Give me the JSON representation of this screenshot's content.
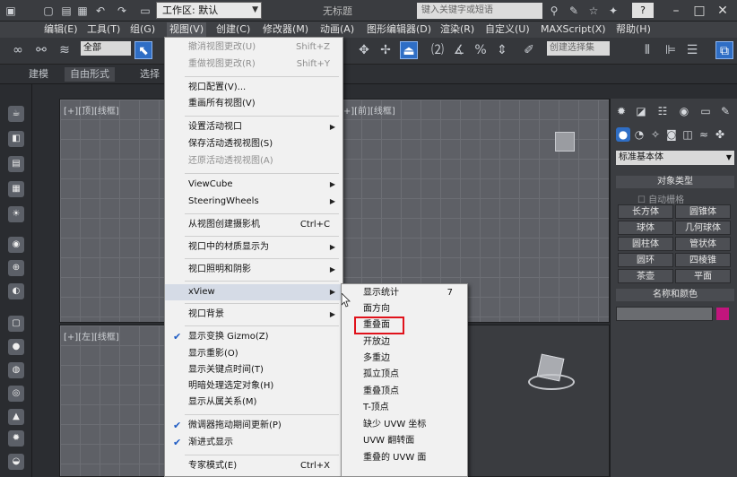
{
  "titlebar": {
    "workspace": "工作区: 默认",
    "title": "无标题",
    "search_placeholder": "键入关键字或短语",
    "help": "?"
  },
  "menubar": {
    "items": [
      "编辑(E)",
      "工具(T)",
      "组(G)",
      "视图(V)",
      "创建(C)",
      "修改器(M)",
      "动画(A)",
      "图形编辑器(D)",
      "渲染(R)",
      "自定义(U)",
      "MAXScript(X)",
      "帮助(H)"
    ]
  },
  "toolbar": {
    "selection_filter": "全部",
    "named_selection": "创建选择集"
  },
  "ribbon": {
    "tabs": [
      "建模",
      "自由形式",
      "选择"
    ]
  },
  "viewports": {
    "top_left_label": "[+][顶][线框]",
    "top_right_label": "[+][前][线框]",
    "bottom_left_label": "[+][左][线框]"
  },
  "view_menu": {
    "items": [
      {
        "label": "撤消视图更改(U)",
        "shortcut": "Shift+Z",
        "disabled": true
      },
      {
        "label": "重做视图更改(R)",
        "shortcut": "Shift+Y",
        "disabled": true
      },
      {
        "label": "视口配置(V)..."
      },
      {
        "label": "重画所有视图(V)"
      },
      {
        "label": "设置活动视口",
        "submenu": true
      },
      {
        "label": "保存活动透视视图(S)"
      },
      {
        "label": "还原活动透视视图(A)",
        "disabled": true
      },
      {
        "label": "ViewCube",
        "submenu": true
      },
      {
        "label": "SteeringWheels",
        "submenu": true
      },
      {
        "label": "从视图创建摄影机",
        "shortcut": "Ctrl+C"
      },
      {
        "label": "视口中的材质显示为",
        "submenu": true
      },
      {
        "label": "视口照明和阴影",
        "submenu": true
      },
      {
        "label": "xView",
        "submenu": true
      },
      {
        "label": "视口背景",
        "submenu": true
      },
      {
        "label": "显示变换 Gizmo(Z)",
        "checked": true
      },
      {
        "label": "显示重影(O)"
      },
      {
        "label": "显示关键点时间(T)"
      },
      {
        "label": "明暗处理选定对象(H)"
      },
      {
        "label": "显示从属关系(M)"
      },
      {
        "label": "微调器拖动期间更新(P)",
        "checked": true
      },
      {
        "label": "渐进式显示",
        "checked": true
      },
      {
        "label": "专家模式(E)",
        "shortcut": "Ctrl+X"
      }
    ]
  },
  "xview_submenu": {
    "items": [
      {
        "label": "显示统计",
        "shortcut": "7"
      },
      {
        "label": "面方向"
      },
      {
        "label": "重叠面"
      },
      {
        "label": "开放边"
      },
      {
        "label": "多重边"
      },
      {
        "label": "孤立顶点"
      },
      {
        "label": "重叠顶点"
      },
      {
        "label": "T-顶点"
      },
      {
        "label": "缺少 UVW 坐标"
      },
      {
        "label": "UVW 翻转面"
      },
      {
        "label": "重叠的 UVW 面"
      }
    ],
    "highlighted": "重叠面"
  },
  "command_panel": {
    "dropdown": "标准基本体",
    "object_type_header": "对象类型",
    "autogrid": "自动栅格",
    "buttons": [
      "长方体",
      "圆锥体",
      "球体",
      "几何球体",
      "圆柱体",
      "管状体",
      "圆环",
      "四棱锥",
      "茶壶",
      "平面"
    ],
    "name_color_header": "名称和颜色",
    "swatch_color": "#c2157d"
  }
}
